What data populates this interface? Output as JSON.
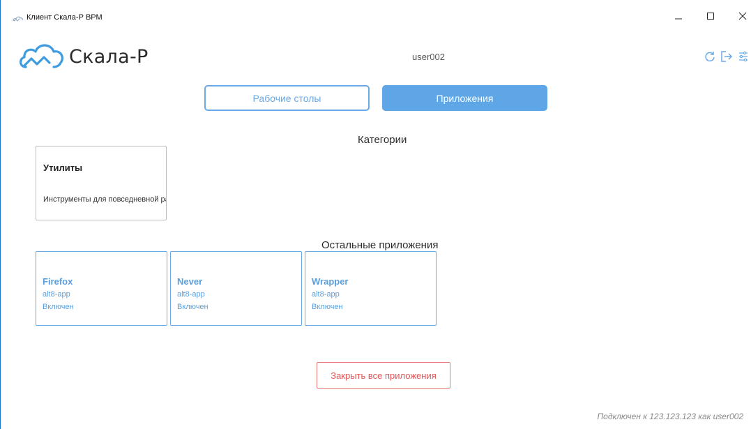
{
  "window": {
    "title": "Клиент Скала-Р ВРМ",
    "controls": {
      "minimize": "minimize-icon",
      "maximize": "maximize-icon",
      "close": "close-icon"
    }
  },
  "header": {
    "brand": "Скала-Р",
    "user": "user002",
    "icons": [
      "refresh-icon",
      "logout-icon",
      "settings-icon"
    ]
  },
  "tabs": [
    {
      "label": "Рабочие столы",
      "active": false
    },
    {
      "label": "Приложения",
      "active": true
    }
  ],
  "categories": {
    "title": "Категории",
    "items": [
      {
        "name": "Утилиты",
        "description": "Инструменты для повседневной работы"
      }
    ]
  },
  "other_apps": {
    "title": "Остальные приложения",
    "items": [
      {
        "name": "Firefox",
        "tag": "alt8-app",
        "status": "Включен"
      },
      {
        "name": "Never",
        "tag": "alt8-app",
        "status": "Включен"
      },
      {
        "name": "Wrapper",
        "tag": "alt8-app",
        "status": "Включен"
      }
    ]
  },
  "actions": {
    "close_all": "Закрыть все приложения"
  },
  "status": "Подключен к 123.123.123 как user002",
  "colors": {
    "accent": "#5ea6e6",
    "accent_text": "#5a9fdc",
    "danger": "#e05555",
    "muted": "#8a8a8a"
  }
}
